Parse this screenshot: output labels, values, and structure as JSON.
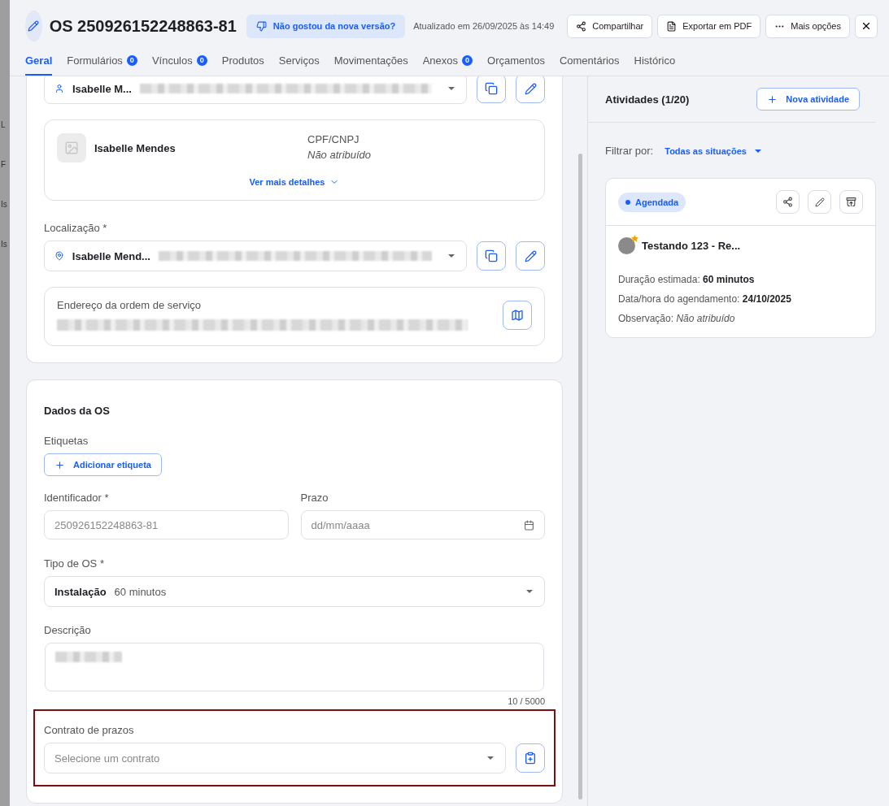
{
  "backdrop_letters": [
    "L",
    "F",
    "Is",
    "Is"
  ],
  "header": {
    "title": "OS 250926152248863-81",
    "feedback_button": "Não gostou da nova versão?",
    "updated": "Atualizado em 26/09/2025 às 14:49",
    "actions": [
      {
        "kind": "share",
        "label": "Compartilhar"
      },
      {
        "kind": "pdf",
        "label": "Exportar em PDF"
      },
      {
        "kind": "more",
        "label": "Mais opções"
      }
    ]
  },
  "tabs": [
    {
      "label": "Geral",
      "selected": true
    },
    {
      "label": "Formulários",
      "count": "0",
      "selected": false
    },
    {
      "label": "Vínculos",
      "count": "0",
      "selected": false
    },
    {
      "label": "Produtos",
      "selected": false
    },
    {
      "label": "Serviços",
      "selected": false
    },
    {
      "label": "Movimentações",
      "selected": false
    },
    {
      "label": "Anexos",
      "count": "0",
      "selected": false
    },
    {
      "label": "Orçamentos",
      "selected": false
    },
    {
      "label": "Comentários",
      "selected": false
    },
    {
      "label": "Histórico",
      "selected": false
    }
  ],
  "client": {
    "value": "Isabelle M...",
    "name": "Isabelle Mendes",
    "doc_label": "CPF/CNPJ",
    "doc_value": "Não atribuído",
    "more_link": "Ver mais detalhes"
  },
  "location": {
    "label": "Localização *",
    "value": "Isabelle Mend...",
    "address_label": "Endereço da ordem de serviço"
  },
  "os_data": {
    "title": "Dados da OS",
    "tags_label": "Etiquetas",
    "add_tag_button": "Adicionar etiqueta",
    "identifier": {
      "label": "Identificador *",
      "placeholder": "250926152248863-81"
    },
    "deadline": {
      "label": "Prazo",
      "placeholder": "dd/mm/aaaa"
    },
    "type": {
      "label": "Tipo de OS *",
      "name": "Instalação",
      "duration": "60 minutos"
    },
    "description": {
      "label": "Descrição",
      "counter": "10 / 5000"
    },
    "contract": {
      "label": "Contrato de prazos",
      "placeholder": "Selecione um contrato",
      "highlighted": true
    }
  },
  "activities": {
    "title": "Atividades (1/20)",
    "new_button": "Nova atividade",
    "filter_label": "Filtrar por:",
    "filter_value": "Todas as situações",
    "cards": [
      {
        "status": "Agendada",
        "color": "#1a5cff",
        "title": "Testando 123 - Re...",
        "starred": true,
        "fields": [
          {
            "label": "Duração estimada:",
            "value": "60 minutos",
            "kind": "value"
          },
          {
            "label": "Data/hora do agendamento:",
            "value": "24/10/2025",
            "kind": "value"
          },
          {
            "label": "Observação:",
            "value": "Não atribuído",
            "kind": "empty"
          }
        ]
      }
    ]
  }
}
